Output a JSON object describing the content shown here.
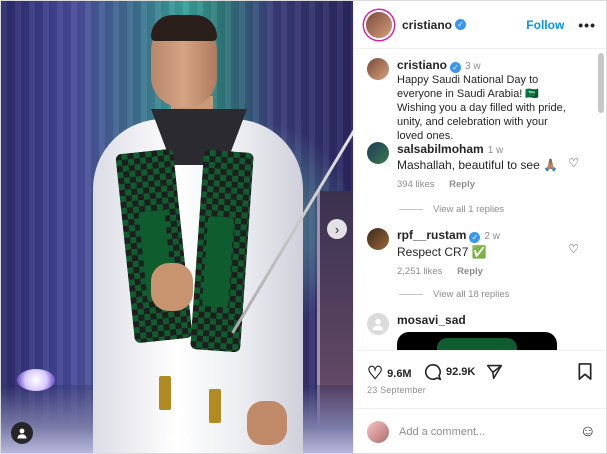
{
  "post": {
    "author": "cristiano",
    "follow_label": "Follow",
    "more_icon": "more-icon",
    "image_dots": 3,
    "active_dot": 0
  },
  "caption": {
    "author": "cristiano",
    "time": "3 w",
    "text": "Happy Saudi National Day to everyone in Saudi Arabia! 🇸🇦 Wishing you a day filled with pride, unity, and celebration with your loved ones."
  },
  "comments": [
    {
      "user": "salsabilmoham",
      "time": "1 w",
      "text": "Mashallah, beautiful to see 🙏🏽",
      "likes": "394 likes",
      "reply": "Reply",
      "view_replies": "View all 1 replies"
    },
    {
      "user": "rpf__rustam",
      "time": "2 w",
      "text": "Respect CR7 ✅",
      "likes": "2,251 likes",
      "reply": "Reply",
      "view_replies": "View all 18 replies"
    },
    {
      "user": "mosavi_sad"
    }
  ],
  "actions": {
    "likes": "9.6M",
    "comments": "92.9K",
    "date": "23 September"
  },
  "add_comment": {
    "placeholder": "Add a comment..."
  },
  "colors": {
    "accent": "#0095f6",
    "verified": "#3897f0",
    "muted": "#8e8e8e"
  }
}
